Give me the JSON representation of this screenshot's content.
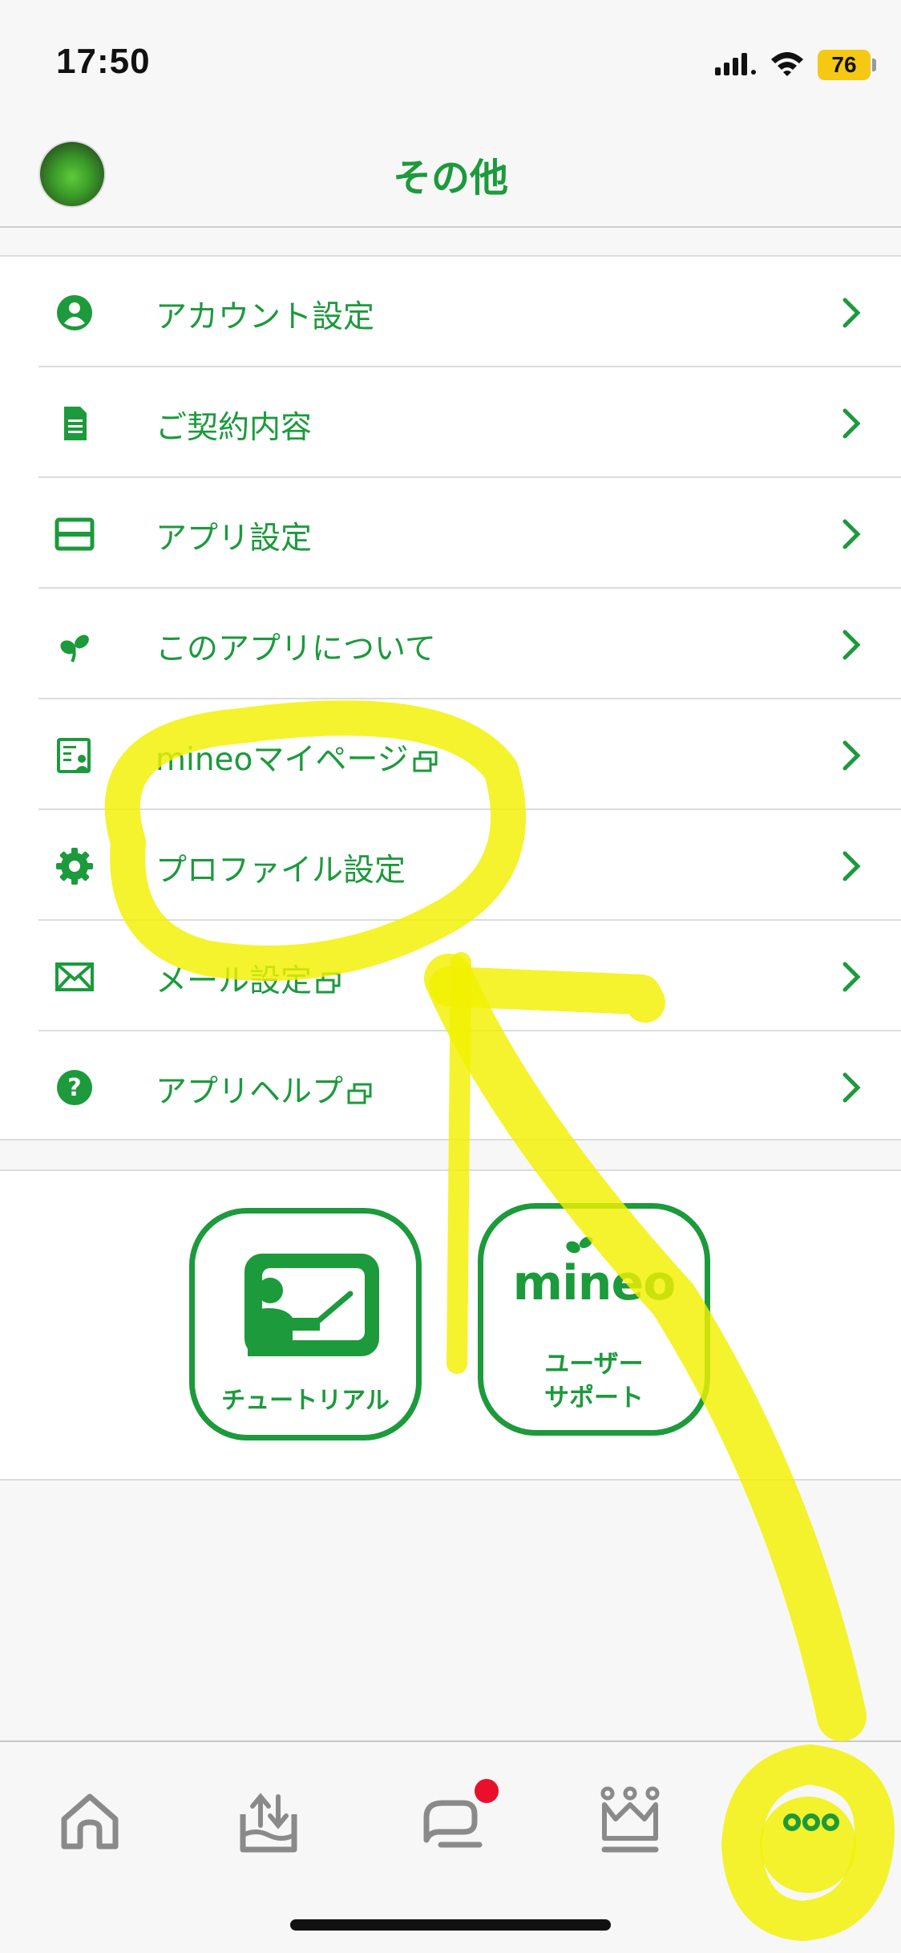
{
  "status_bar": {
    "time": "17:50",
    "battery": "76",
    "battery_color": "#f5c814"
  },
  "header": {
    "title": "その他"
  },
  "menu": {
    "items": [
      {
        "label": "アカウント設定",
        "icon": "account-icon",
        "external": false
      },
      {
        "label": "ご契約内容",
        "icon": "contract-document-icon",
        "external": false
      },
      {
        "label": "アプリ設定",
        "icon": "app-settings-icon",
        "external": false
      },
      {
        "label": "このアプリについて",
        "icon": "mineo-leaf-icon",
        "external": false
      },
      {
        "label": "mineoマイページ",
        "icon": "mypage-icon",
        "external": true
      },
      {
        "label": "プロファイル設定",
        "icon": "gear-icon",
        "external": false
      },
      {
        "label": "メール設定",
        "icon": "mail-icon",
        "external": true
      },
      {
        "label": "アプリヘルプ",
        "icon": "help-icon",
        "external": true
      }
    ]
  },
  "shortcuts": {
    "tutorial_label": "チュートリアル",
    "support_logo": "mineo",
    "support_label_line1": "ユーザー",
    "support_label_line2": "サポート"
  },
  "tab_bar": {
    "tabs": [
      {
        "icon": "home-icon"
      },
      {
        "icon": "data-share-icon"
      },
      {
        "icon": "chat-icon",
        "badge": true
      },
      {
        "icon": "crown-icon"
      },
      {
        "icon": "more-icon",
        "active": true
      }
    ]
  },
  "colors": {
    "accent": "#1c9a3c",
    "tab_inactive": "#8a8a8a",
    "badge": "#e8102a",
    "highlight_annotation": "#f2f000"
  }
}
